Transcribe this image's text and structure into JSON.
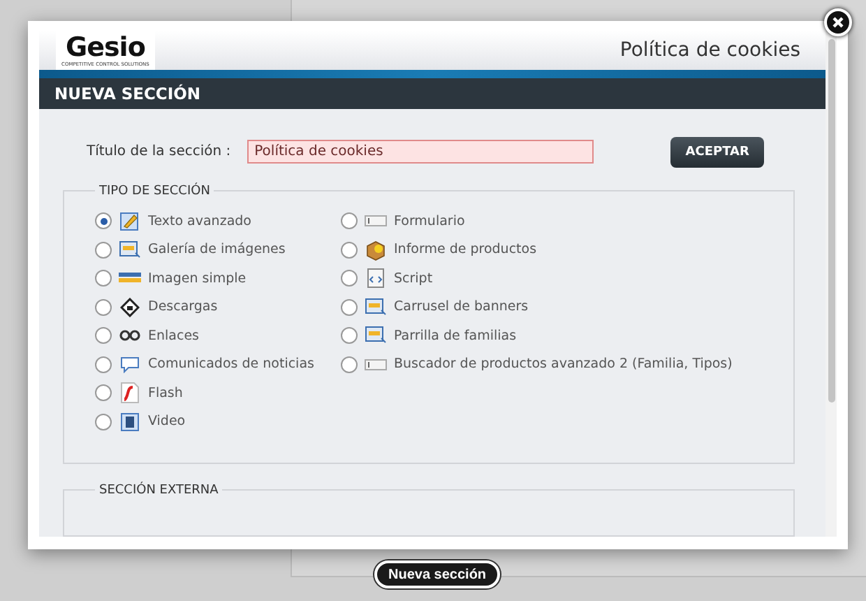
{
  "modal": {
    "logo_text": "Gesio",
    "logo_tagline": "COMPETITIVE CONTROL SOLUTIONS",
    "header_title": "Política de cookies",
    "section_bar": "NUEVA SECCIÓN",
    "title_label": "Título de la sección :",
    "title_value": "Política de cookies",
    "accept_button": "ACEPTAR",
    "section_type": {
      "legend": "TIPO DE SECCIÓN",
      "columns": [
        [
          {
            "label": "Texto avanzado",
            "selected": true
          },
          {
            "label": "Galería de imágenes",
            "selected": false
          },
          {
            "label": "Imagen simple",
            "selected": false
          },
          {
            "label": "Descargas",
            "selected": false
          },
          {
            "label": "Enlaces",
            "selected": false
          },
          {
            "label": "Comunicados de noticias",
            "selected": false
          },
          {
            "label": "Flash",
            "selected": false
          },
          {
            "label": "Video",
            "selected": false
          }
        ],
        [
          {
            "label": "Formulario",
            "selected": false
          },
          {
            "label": "Informe de productos",
            "selected": false
          },
          {
            "label": "Script",
            "selected": false
          },
          {
            "label": "Carrusel de banners",
            "selected": false
          },
          {
            "label": "Parrilla de familias",
            "selected": false
          },
          {
            "label": "Buscador de productos avanzado 2 (Familia, Tipos)",
            "selected": false
          }
        ]
      ]
    },
    "external_legend": "SECCIÓN EXTERNA"
  },
  "page_button": "Nueva sección"
}
